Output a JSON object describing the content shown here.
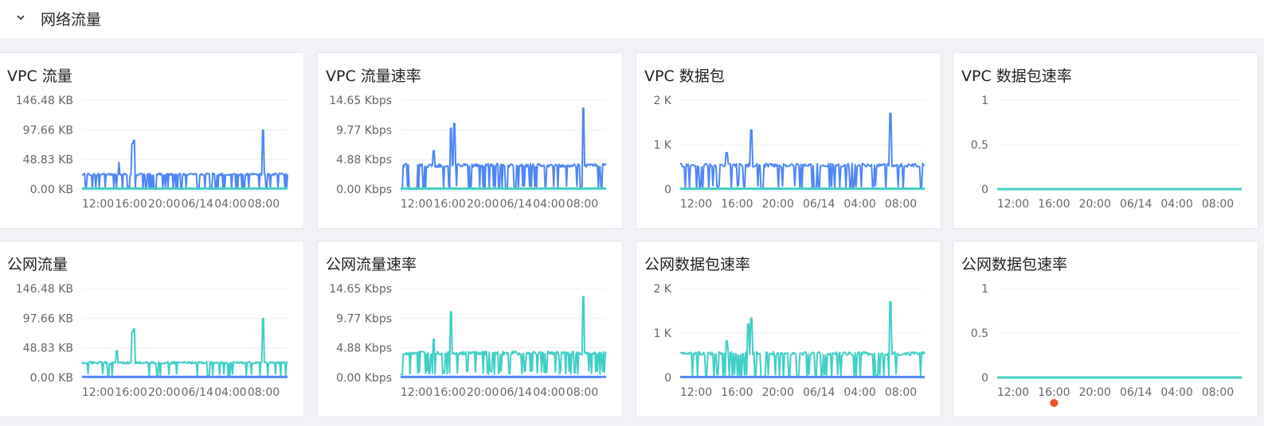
{
  "section": {
    "title": "网络流量",
    "collapse_icon": "chevron-down-icon"
  },
  "colors": {
    "blue": "#4f86f7",
    "teal": "#40cfc6",
    "grid": "#eef0f3",
    "axis_text": "#666666",
    "marker": "#f04e23"
  },
  "x_ticks": [
    "12:00",
    "16:00",
    "20:00",
    "06/14",
    "04:00",
    "08:00"
  ],
  "charts": [
    {
      "title": "VPC 流量",
      "type": "line",
      "y_ticks": [
        "146.48 KB",
        "97.66 KB",
        "48.83 KB",
        "0.00 KB"
      ],
      "ylim": [
        0,
        146.48
      ],
      "chart_data": {
        "type": "area",
        "unit": "KB",
        "series": [
          {
            "color": "#4f86f7",
            "pattern": {
              "base": 25,
              "low": 0,
              "dense": true,
              "spikes": [
                [
                  0.18,
                  44
                ],
                [
                  0.245,
                  75
                ],
                [
                  0.255,
                  80
                ],
                [
                  0.88,
                  97
                ]
              ],
              "gaps": [
                [
                  0.35,
                  0.36
                ],
                [
                  0.56,
                  0.57
                ],
                [
                  0.62,
                  0.63
                ]
              ]
            }
          },
          {
            "color": "#40cfc6",
            "pattern": {
              "flat": 1
            }
          }
        ]
      }
    },
    {
      "title": "VPC 流量速率",
      "type": "line",
      "y_ticks": [
        "14.65 Kbps",
        "9.77 Kbps",
        "4.88 Kbps",
        "0.00 Kbps"
      ],
      "ylim": [
        0,
        14.65
      ],
      "chart_data": {
        "type": "area",
        "unit": "Kbps",
        "series": [
          {
            "color": "#4f86f7",
            "pattern": {
              "base": 4,
              "low": 0,
              "dense": true,
              "spikes": [
                [
                  0.16,
                  6.3
                ],
                [
                  0.245,
                  10
                ],
                [
                  0.26,
                  10.8
                ],
                [
                  0.89,
                  13.3
                ]
              ],
              "gaps": [
                [
                  0.0,
                  0.01
                ],
                [
                  0.04,
                  0.08
                ],
                [
                  0.51,
                  0.52
                ]
              ]
            }
          },
          {
            "color": "#40cfc6",
            "pattern": {
              "flat": 0.1
            }
          }
        ]
      }
    },
    {
      "title": "VPC 数据包",
      "type": "line",
      "y_ticks": [
        "2 K",
        "1 K",
        "0"
      ],
      "ylim": [
        0,
        2000
      ],
      "chart_data": {
        "type": "area",
        "unit": "",
        "series": [
          {
            "color": "#4f86f7",
            "pattern": {
              "base": 550,
              "low": 0,
              "dense": true,
              "spikes": [
                [
                  0.19,
                  820
                ],
                [
                  0.29,
                  1330
                ],
                [
                  0.86,
                  1700
                ]
              ],
              "gaps": [
                [
                  0.33,
                  0.34
                ],
                [
                  0.55,
                  0.56
                ]
              ]
            }
          },
          {
            "color": "#40cfc6",
            "pattern": {
              "flat": 10
            }
          }
        ]
      }
    },
    {
      "title": "VPC 数据包速率",
      "type": "line",
      "y_ticks": [
        "1",
        "0.5",
        "0"
      ],
      "ylim": [
        0,
        1
      ],
      "chart_data": {
        "type": "line",
        "unit": "",
        "series": [
          {
            "color": "#40cfc6",
            "pattern": {
              "flat": 0
            }
          }
        ]
      }
    },
    {
      "title": "公网流量",
      "type": "line",
      "y_ticks": [
        "146.48 KB",
        "97.66 KB",
        "48.83 KB",
        "0.00 KB"
      ],
      "ylim": [
        0,
        146.48
      ],
      "chart_data": {
        "type": "area",
        "unit": "KB",
        "series": [
          {
            "color": "#40cfc6",
            "pattern": {
              "base": 25,
              "low": 3,
              "dense": false,
              "spikes": [
                [
                  0.17,
                  44
                ],
                [
                  0.245,
                  75
                ],
                [
                  0.255,
                  80
                ],
                [
                  0.88,
                  97
                ]
              ],
              "gaps": [
                [
                  0.36,
                  0.37
                ],
                [
                  0.61,
                  0.62
                ]
              ]
            }
          },
          {
            "color": "#4f86f7",
            "pattern": {
              "flat": 1
            }
          }
        ]
      }
    },
    {
      "title": "公网流量速率",
      "type": "line",
      "y_ticks": [
        "14.65 Kbps",
        "9.77 Kbps",
        "4.88 Kbps",
        "0.00 Kbps"
      ],
      "ylim": [
        0,
        14.65
      ],
      "chart_data": {
        "type": "area",
        "unit": "Kbps",
        "series": [
          {
            "color": "#40cfc6",
            "pattern": {
              "base": 4.1,
              "low": 0.5,
              "dense": true,
              "spikes": [
                [
                  0.16,
                  6.3
                ],
                [
                  0.245,
                  10.8
                ],
                [
                  0.89,
                  13.3
                ]
              ],
              "gaps": [
                [
                  0.0,
                  0.01
                ]
              ]
            }
          },
          {
            "color": "#4f86f7",
            "pattern": {
              "flat": 0.1
            }
          }
        ]
      }
    },
    {
      "title": "公网数据包速率",
      "type": "line",
      "y_ticks": [
        "2 K",
        "1 K",
        "0"
      ],
      "ylim": [
        0,
        2000
      ],
      "chart_data": {
        "type": "area",
        "unit": "",
        "series": [
          {
            "color": "#40cfc6",
            "pattern": {
              "base": 550,
              "low": 0,
              "dense": true,
              "spikes": [
                [
                  0.19,
                  820
                ],
                [
                  0.28,
                  1200
                ],
                [
                  0.29,
                  1330
                ],
                [
                  0.86,
                  1700
                ]
              ],
              "gaps": [
                [
                  0.33,
                  0.34
                ],
                [
                  0.55,
                  0.56
                ]
              ]
            }
          },
          {
            "color": "#4f86f7",
            "pattern": {
              "flat": 10
            }
          }
        ]
      }
    },
    {
      "title": "公网数据包速率",
      "type": "line",
      "y_ticks": [
        "1",
        "0.5",
        "0"
      ],
      "ylim": [
        0,
        1
      ],
      "chart_data": {
        "type": "line",
        "unit": "",
        "series": [
          {
            "color": "#40cfc6",
            "pattern": {
              "flat": 0
            }
          }
        ],
        "marker": {
          "x": 0.27,
          "color": "#f04e23"
        }
      }
    }
  ]
}
